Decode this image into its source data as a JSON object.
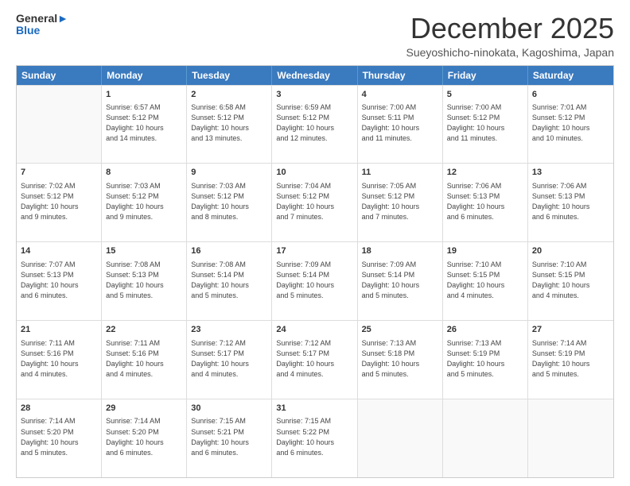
{
  "logo": {
    "line1": "General",
    "line2": "Blue"
  },
  "title": "December 2025",
  "location": "Sueyoshicho-ninokata, Kagoshima, Japan",
  "weekdays": [
    "Sunday",
    "Monday",
    "Tuesday",
    "Wednesday",
    "Thursday",
    "Friday",
    "Saturday"
  ],
  "weeks": [
    [
      {
        "day": "",
        "info": ""
      },
      {
        "day": "1",
        "info": "Sunrise: 6:57 AM\nSunset: 5:12 PM\nDaylight: 10 hours\nand 14 minutes."
      },
      {
        "day": "2",
        "info": "Sunrise: 6:58 AM\nSunset: 5:12 PM\nDaylight: 10 hours\nand 13 minutes."
      },
      {
        "day": "3",
        "info": "Sunrise: 6:59 AM\nSunset: 5:12 PM\nDaylight: 10 hours\nand 12 minutes."
      },
      {
        "day": "4",
        "info": "Sunrise: 7:00 AM\nSunset: 5:11 PM\nDaylight: 10 hours\nand 11 minutes."
      },
      {
        "day": "5",
        "info": "Sunrise: 7:00 AM\nSunset: 5:12 PM\nDaylight: 10 hours\nand 11 minutes."
      },
      {
        "day": "6",
        "info": "Sunrise: 7:01 AM\nSunset: 5:12 PM\nDaylight: 10 hours\nand 10 minutes."
      }
    ],
    [
      {
        "day": "7",
        "info": "Sunrise: 7:02 AM\nSunset: 5:12 PM\nDaylight: 10 hours\nand 9 minutes."
      },
      {
        "day": "8",
        "info": "Sunrise: 7:03 AM\nSunset: 5:12 PM\nDaylight: 10 hours\nand 9 minutes."
      },
      {
        "day": "9",
        "info": "Sunrise: 7:03 AM\nSunset: 5:12 PM\nDaylight: 10 hours\nand 8 minutes."
      },
      {
        "day": "10",
        "info": "Sunrise: 7:04 AM\nSunset: 5:12 PM\nDaylight: 10 hours\nand 7 minutes."
      },
      {
        "day": "11",
        "info": "Sunrise: 7:05 AM\nSunset: 5:12 PM\nDaylight: 10 hours\nand 7 minutes."
      },
      {
        "day": "12",
        "info": "Sunrise: 7:06 AM\nSunset: 5:13 PM\nDaylight: 10 hours\nand 6 minutes."
      },
      {
        "day": "13",
        "info": "Sunrise: 7:06 AM\nSunset: 5:13 PM\nDaylight: 10 hours\nand 6 minutes."
      }
    ],
    [
      {
        "day": "14",
        "info": "Sunrise: 7:07 AM\nSunset: 5:13 PM\nDaylight: 10 hours\nand 6 minutes."
      },
      {
        "day": "15",
        "info": "Sunrise: 7:08 AM\nSunset: 5:13 PM\nDaylight: 10 hours\nand 5 minutes."
      },
      {
        "day": "16",
        "info": "Sunrise: 7:08 AM\nSunset: 5:14 PM\nDaylight: 10 hours\nand 5 minutes."
      },
      {
        "day": "17",
        "info": "Sunrise: 7:09 AM\nSunset: 5:14 PM\nDaylight: 10 hours\nand 5 minutes."
      },
      {
        "day": "18",
        "info": "Sunrise: 7:09 AM\nSunset: 5:14 PM\nDaylight: 10 hours\nand 5 minutes."
      },
      {
        "day": "19",
        "info": "Sunrise: 7:10 AM\nSunset: 5:15 PM\nDaylight: 10 hours\nand 4 minutes."
      },
      {
        "day": "20",
        "info": "Sunrise: 7:10 AM\nSunset: 5:15 PM\nDaylight: 10 hours\nand 4 minutes."
      }
    ],
    [
      {
        "day": "21",
        "info": "Sunrise: 7:11 AM\nSunset: 5:16 PM\nDaylight: 10 hours\nand 4 minutes."
      },
      {
        "day": "22",
        "info": "Sunrise: 7:11 AM\nSunset: 5:16 PM\nDaylight: 10 hours\nand 4 minutes."
      },
      {
        "day": "23",
        "info": "Sunrise: 7:12 AM\nSunset: 5:17 PM\nDaylight: 10 hours\nand 4 minutes."
      },
      {
        "day": "24",
        "info": "Sunrise: 7:12 AM\nSunset: 5:17 PM\nDaylight: 10 hours\nand 4 minutes."
      },
      {
        "day": "25",
        "info": "Sunrise: 7:13 AM\nSunset: 5:18 PM\nDaylight: 10 hours\nand 5 minutes."
      },
      {
        "day": "26",
        "info": "Sunrise: 7:13 AM\nSunset: 5:19 PM\nDaylight: 10 hours\nand 5 minutes."
      },
      {
        "day": "27",
        "info": "Sunrise: 7:14 AM\nSunset: 5:19 PM\nDaylight: 10 hours\nand 5 minutes."
      }
    ],
    [
      {
        "day": "28",
        "info": "Sunrise: 7:14 AM\nSunset: 5:20 PM\nDaylight: 10 hours\nand 5 minutes."
      },
      {
        "day": "29",
        "info": "Sunrise: 7:14 AM\nSunset: 5:20 PM\nDaylight: 10 hours\nand 6 minutes."
      },
      {
        "day": "30",
        "info": "Sunrise: 7:15 AM\nSunset: 5:21 PM\nDaylight: 10 hours\nand 6 minutes."
      },
      {
        "day": "31",
        "info": "Sunrise: 7:15 AM\nSunset: 5:22 PM\nDaylight: 10 hours\nand 6 minutes."
      },
      {
        "day": "",
        "info": ""
      },
      {
        "day": "",
        "info": ""
      },
      {
        "day": "",
        "info": ""
      }
    ]
  ]
}
